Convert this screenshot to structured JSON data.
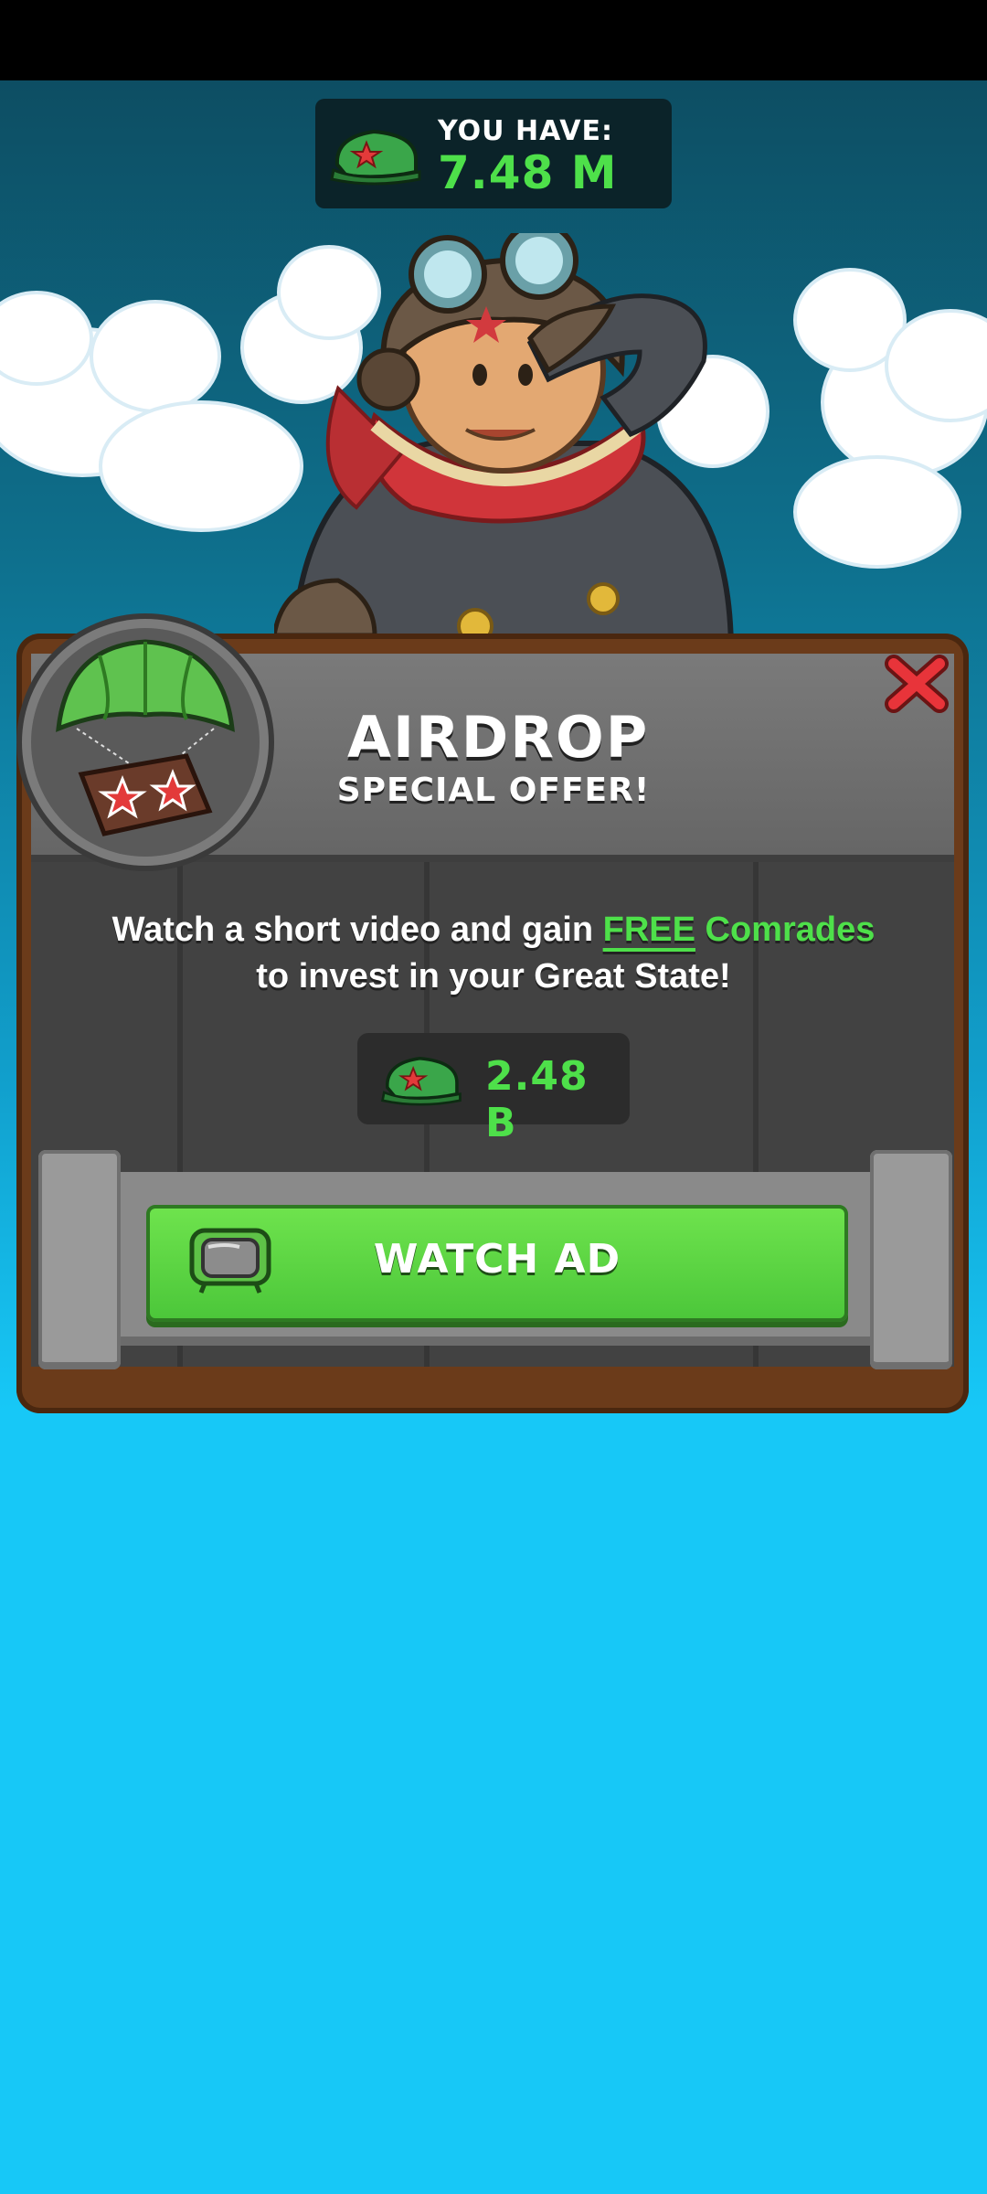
{
  "balance": {
    "label": "YOU HAVE:",
    "amount": "7.48 M"
  },
  "offer": {
    "title": "AIRDROP",
    "subtitle": "SPECIAL OFFER!",
    "description_part1": "Watch a short video and gain ",
    "description_free": "FREE",
    "description_comrades": " Comrades",
    "description_part2": "to invest in your Great State!",
    "reward_amount": "2.48 B",
    "button_label": "WATCH AD"
  },
  "icons": {
    "currency": "comrade-cap-icon",
    "close": "close-icon",
    "badge": "airdrop-crate-icon",
    "button": "tv-icon"
  },
  "colors": {
    "accent_green": "#4ee04a",
    "button_green": "#5fd943",
    "close_red": "#e8343a",
    "sky_top": "#0d4e63",
    "sky_bottom": "#17c8f7"
  }
}
